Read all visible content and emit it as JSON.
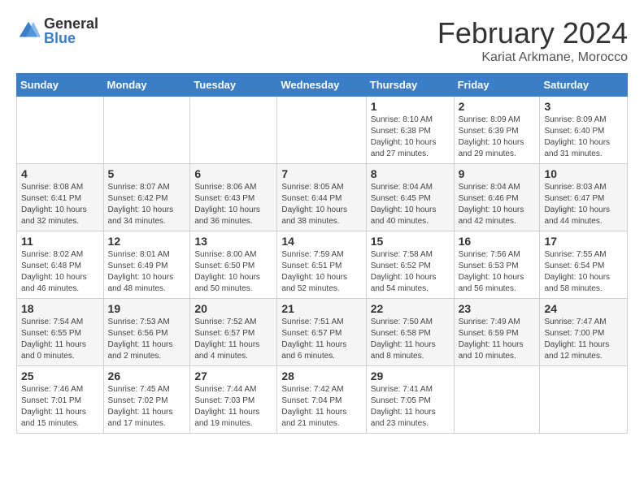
{
  "logo": {
    "general": "General",
    "blue": "Blue"
  },
  "title": "February 2024",
  "location": "Kariat Arkmane, Morocco",
  "days_header": [
    "Sunday",
    "Monday",
    "Tuesday",
    "Wednesday",
    "Thursday",
    "Friday",
    "Saturday"
  ],
  "weeks": [
    [
      {
        "day": "",
        "info": ""
      },
      {
        "day": "",
        "info": ""
      },
      {
        "day": "",
        "info": ""
      },
      {
        "day": "",
        "info": ""
      },
      {
        "day": "1",
        "info": "Sunrise: 8:10 AM\nSunset: 6:38 PM\nDaylight: 10 hours\nand 27 minutes."
      },
      {
        "day": "2",
        "info": "Sunrise: 8:09 AM\nSunset: 6:39 PM\nDaylight: 10 hours\nand 29 minutes."
      },
      {
        "day": "3",
        "info": "Sunrise: 8:09 AM\nSunset: 6:40 PM\nDaylight: 10 hours\nand 31 minutes."
      }
    ],
    [
      {
        "day": "4",
        "info": "Sunrise: 8:08 AM\nSunset: 6:41 PM\nDaylight: 10 hours\nand 32 minutes."
      },
      {
        "day": "5",
        "info": "Sunrise: 8:07 AM\nSunset: 6:42 PM\nDaylight: 10 hours\nand 34 minutes."
      },
      {
        "day": "6",
        "info": "Sunrise: 8:06 AM\nSunset: 6:43 PM\nDaylight: 10 hours\nand 36 minutes."
      },
      {
        "day": "7",
        "info": "Sunrise: 8:05 AM\nSunset: 6:44 PM\nDaylight: 10 hours\nand 38 minutes."
      },
      {
        "day": "8",
        "info": "Sunrise: 8:04 AM\nSunset: 6:45 PM\nDaylight: 10 hours\nand 40 minutes."
      },
      {
        "day": "9",
        "info": "Sunrise: 8:04 AM\nSunset: 6:46 PM\nDaylight: 10 hours\nand 42 minutes."
      },
      {
        "day": "10",
        "info": "Sunrise: 8:03 AM\nSunset: 6:47 PM\nDaylight: 10 hours\nand 44 minutes."
      }
    ],
    [
      {
        "day": "11",
        "info": "Sunrise: 8:02 AM\nSunset: 6:48 PM\nDaylight: 10 hours\nand 46 minutes."
      },
      {
        "day": "12",
        "info": "Sunrise: 8:01 AM\nSunset: 6:49 PM\nDaylight: 10 hours\nand 48 minutes."
      },
      {
        "day": "13",
        "info": "Sunrise: 8:00 AM\nSunset: 6:50 PM\nDaylight: 10 hours\nand 50 minutes."
      },
      {
        "day": "14",
        "info": "Sunrise: 7:59 AM\nSunset: 6:51 PM\nDaylight: 10 hours\nand 52 minutes."
      },
      {
        "day": "15",
        "info": "Sunrise: 7:58 AM\nSunset: 6:52 PM\nDaylight: 10 hours\nand 54 minutes."
      },
      {
        "day": "16",
        "info": "Sunrise: 7:56 AM\nSunset: 6:53 PM\nDaylight: 10 hours\nand 56 minutes."
      },
      {
        "day": "17",
        "info": "Sunrise: 7:55 AM\nSunset: 6:54 PM\nDaylight: 10 hours\nand 58 minutes."
      }
    ],
    [
      {
        "day": "18",
        "info": "Sunrise: 7:54 AM\nSunset: 6:55 PM\nDaylight: 11 hours\nand 0 minutes."
      },
      {
        "day": "19",
        "info": "Sunrise: 7:53 AM\nSunset: 6:56 PM\nDaylight: 11 hours\nand 2 minutes."
      },
      {
        "day": "20",
        "info": "Sunrise: 7:52 AM\nSunset: 6:57 PM\nDaylight: 11 hours\nand 4 minutes."
      },
      {
        "day": "21",
        "info": "Sunrise: 7:51 AM\nSunset: 6:57 PM\nDaylight: 11 hours\nand 6 minutes."
      },
      {
        "day": "22",
        "info": "Sunrise: 7:50 AM\nSunset: 6:58 PM\nDaylight: 11 hours\nand 8 minutes."
      },
      {
        "day": "23",
        "info": "Sunrise: 7:49 AM\nSunset: 6:59 PM\nDaylight: 11 hours\nand 10 minutes."
      },
      {
        "day": "24",
        "info": "Sunrise: 7:47 AM\nSunset: 7:00 PM\nDaylight: 11 hours\nand 12 minutes."
      }
    ],
    [
      {
        "day": "25",
        "info": "Sunrise: 7:46 AM\nSunset: 7:01 PM\nDaylight: 11 hours\nand 15 minutes."
      },
      {
        "day": "26",
        "info": "Sunrise: 7:45 AM\nSunset: 7:02 PM\nDaylight: 11 hours\nand 17 minutes."
      },
      {
        "day": "27",
        "info": "Sunrise: 7:44 AM\nSunset: 7:03 PM\nDaylight: 11 hours\nand 19 minutes."
      },
      {
        "day": "28",
        "info": "Sunrise: 7:42 AM\nSunset: 7:04 PM\nDaylight: 11 hours\nand 21 minutes."
      },
      {
        "day": "29",
        "info": "Sunrise: 7:41 AM\nSunset: 7:05 PM\nDaylight: 11 hours\nand 23 minutes."
      },
      {
        "day": "",
        "info": ""
      },
      {
        "day": "",
        "info": ""
      }
    ]
  ]
}
